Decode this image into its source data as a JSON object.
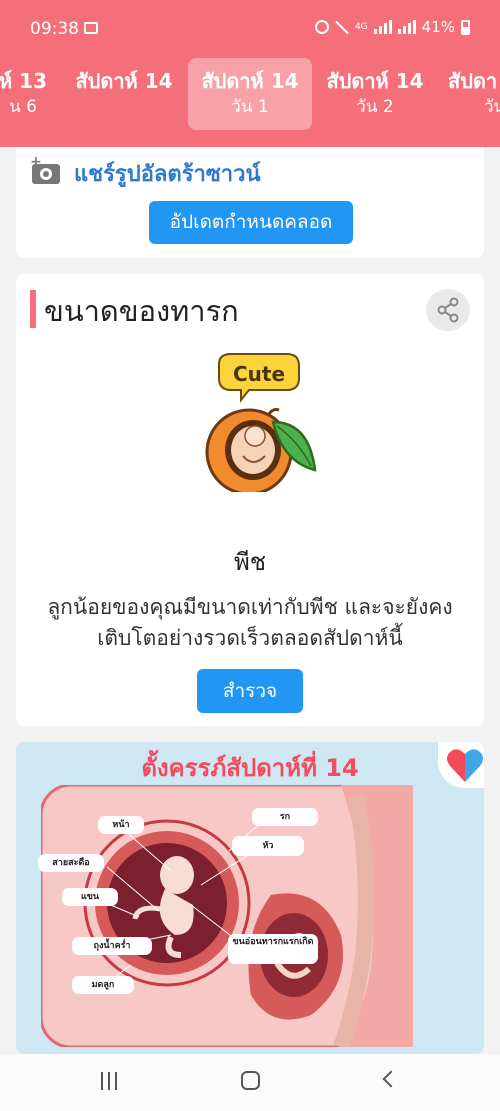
{
  "status_bar": {
    "time": "09:38",
    "network": "4G",
    "battery": "41%"
  },
  "tabs": [
    {
      "week": "ห์ 13",
      "day": "น 6",
      "active": false
    },
    {
      "week": "สัปดาห์ 14",
      "day": "",
      "active": false
    },
    {
      "week": "สัปดาห์ 14",
      "day": "วัน 1",
      "active": true
    },
    {
      "week": "สัปดาห์ 14",
      "day": "วัน 2",
      "active": false
    },
    {
      "week": "สัปดา",
      "day": "วัน",
      "active": false
    }
  ],
  "ultrasound_card": {
    "share_label": "แชร์รูปอัลตร้าซาวน์",
    "update_due_button": "อัปเดตกำหนดคลอด"
  },
  "baby_size_card": {
    "title": "ขนาดของทารก",
    "badge": "Cute",
    "fruit": "พีช",
    "description": "ลูกน้อยของคุณมีขนาดเท่ากับพีช และจะยังคงเติบโตอย่างรวดเร็วตลอดสัปดาห์นี้",
    "explore_button": "สำรวจ"
  },
  "pregnancy_card": {
    "title": "ตั้งครรภ์สัปดาห์ที่ 14",
    "labels": {
      "face": "หน้า",
      "umbilical_cord": "สายสะดือ",
      "arm": "แขน",
      "amniotic_sac": "ถุงน้ำคร่ำ",
      "uterus": "มดลูก",
      "placenta": "รก",
      "head": "หัว",
      "lanugo": "ขนอ่อนทารกแรกเกิด"
    }
  },
  "colors": {
    "header": "#f56f7a",
    "button": "#2196f3",
    "link": "#2f7ad1",
    "accent_bar": "#f56f7a"
  },
  "icons": {
    "camera": "add-photo-icon",
    "share": "share-icon",
    "nav_recent": "recent-apps-icon",
    "nav_home": "home-icon",
    "nav_back": "back-icon"
  }
}
